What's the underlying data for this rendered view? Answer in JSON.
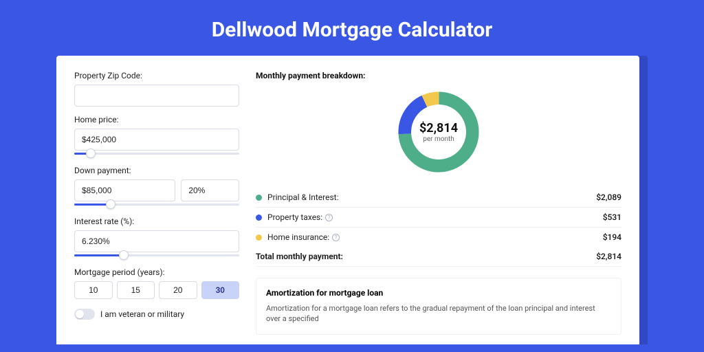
{
  "title": "Dellwood Mortgage Calculator",
  "form": {
    "zip": {
      "label": "Property Zip Code:",
      "value": ""
    },
    "home_price": {
      "label": "Home price:",
      "value": "$425,000",
      "slider_pct": 10
    },
    "down_payment": {
      "label": "Down payment:",
      "value": "$85,000",
      "pct_value": "20%",
      "slider_pct": 22
    },
    "interest": {
      "label": "Interest rate (%):",
      "value": "6.230%",
      "slider_pct": 30
    },
    "period": {
      "label": "Mortgage period (years):",
      "options": [
        "10",
        "15",
        "20",
        "30"
      ],
      "selected": "30"
    },
    "veteran": {
      "label": "I am veteran or military",
      "checked": false
    }
  },
  "breakdown": {
    "title": "Monthly payment breakdown:",
    "center_value": "$2,814",
    "center_label": "per month",
    "items": [
      {
        "label": "Principal & Interest:",
        "value": "$2,089",
        "color": "#4fae8a",
        "pct": 74
      },
      {
        "label": "Property taxes:",
        "value": "$531",
        "color": "#3956e5",
        "pct": 19,
        "info": true
      },
      {
        "label": "Home insurance:",
        "value": "$194",
        "color": "#f2c94c",
        "pct": 7,
        "info": true
      }
    ],
    "total": {
      "label": "Total monthly payment:",
      "value": "$2,814"
    }
  },
  "amortization": {
    "title": "Amortization for mortgage loan",
    "text": "Amortization for a mortgage loan refers to the gradual repayment of the loan principal and interest over a specified"
  },
  "chart_data": {
    "type": "pie",
    "title": "Monthly payment breakdown",
    "series": [
      {
        "name": "Principal & Interest",
        "value": 2089,
        "color": "#4fae8a"
      },
      {
        "name": "Property taxes",
        "value": 531,
        "color": "#3956e5"
      },
      {
        "name": "Home insurance",
        "value": 194,
        "color": "#f2c94c"
      }
    ],
    "total": 2814,
    "center_label": "per month"
  }
}
